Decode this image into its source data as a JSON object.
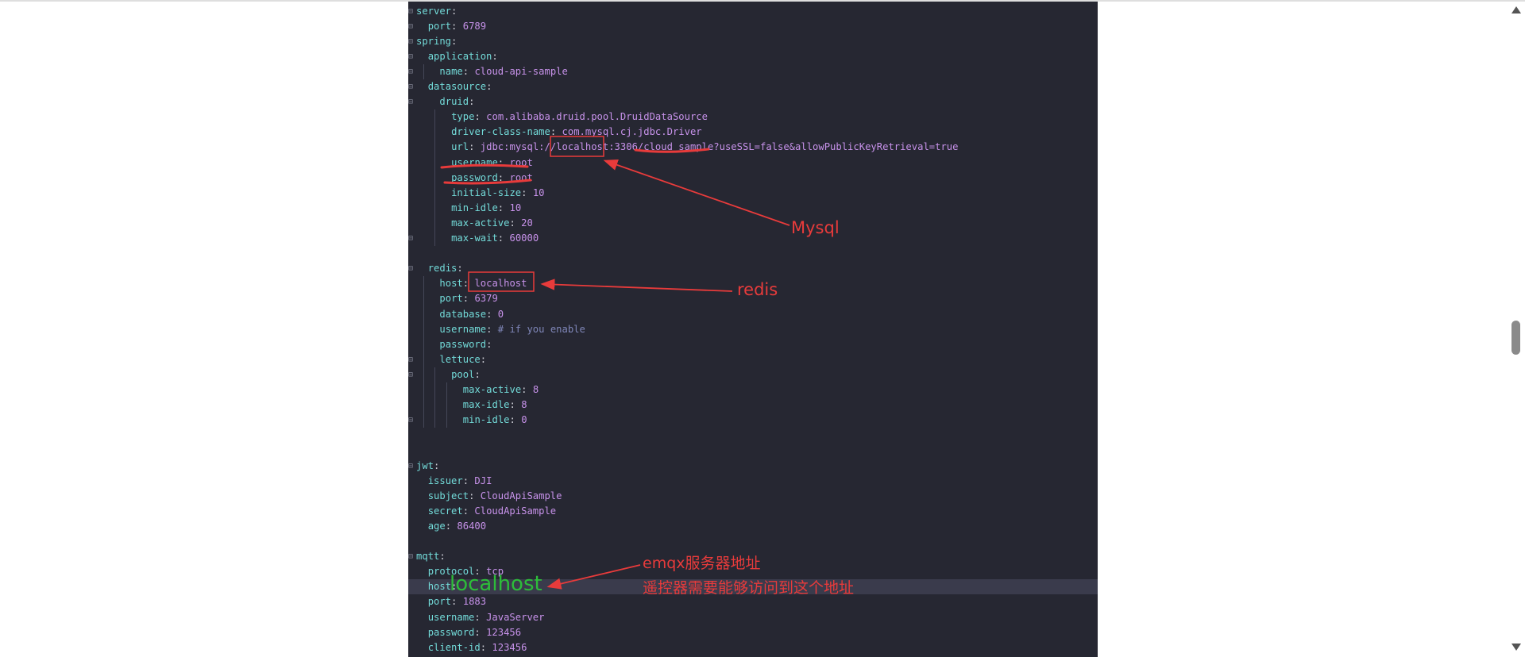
{
  "editor": {
    "lines": [
      {
        "indent": 0,
        "key": "server",
        "sep": ":",
        "value": "",
        "vclass": "v",
        "gutter": "⊟"
      },
      {
        "indent": 1,
        "key": "port",
        "sep": ": ",
        "value": "6789",
        "vclass": "v",
        "gutter": "⊟"
      },
      {
        "indent": 0,
        "key": "spring",
        "sep": ":",
        "value": "",
        "vclass": "v",
        "gutter": "⊟"
      },
      {
        "indent": 1,
        "key": "application",
        "sep": ":",
        "value": "",
        "vclass": "v",
        "gutter": "⊟"
      },
      {
        "indent": 2,
        "key": "name",
        "sep": ": ",
        "value": "cloud-api-sample",
        "vclass": "v",
        "gutter": "⊟"
      },
      {
        "indent": 1,
        "key": "datasource",
        "sep": ":",
        "value": "",
        "vclass": "v",
        "gutter": "⊟"
      },
      {
        "indent": 2,
        "key": "druid",
        "sep": ":",
        "value": "",
        "vclass": "v",
        "gutter": "⊟"
      },
      {
        "indent": 3,
        "key": "type",
        "sep": ": ",
        "value": "com.alibaba.druid.pool.DruidDataSource",
        "vclass": "v",
        "gutter": ""
      },
      {
        "indent": 3,
        "key": "driver-class-name",
        "sep": ": ",
        "value": "com.mysql.cj.jdbc.Driver",
        "vclass": "v",
        "gutter": ""
      },
      {
        "indent": 3,
        "key": "url",
        "sep": ": ",
        "value": "jdbc:mysql://localhost:3306/cloud_sample?useSSL=false&allowPublicKeyRetrieval=true",
        "vclass": "v",
        "gutter": ""
      },
      {
        "indent": 3,
        "key": "username",
        "sep": ": ",
        "value": "root",
        "vclass": "v",
        "gutter": ""
      },
      {
        "indent": 3,
        "key": "password",
        "sep": ": ",
        "value": "root",
        "vclass": "v",
        "gutter": ""
      },
      {
        "indent": 3,
        "key": "initial-size",
        "sep": ": ",
        "value": "10",
        "vclass": "v",
        "gutter": ""
      },
      {
        "indent": 3,
        "key": "min-idle",
        "sep": ": ",
        "value": "10",
        "vclass": "v",
        "gutter": ""
      },
      {
        "indent": 3,
        "key": "max-active",
        "sep": ": ",
        "value": "20",
        "vclass": "v",
        "gutter": ""
      },
      {
        "indent": 3,
        "key": "max-wait",
        "sep": ": ",
        "value": "60000",
        "vclass": "v",
        "gutter": "⊟"
      },
      {
        "indent": 0,
        "key": "",
        "sep": "",
        "value": "",
        "vclass": "v",
        "gutter": ""
      },
      {
        "indent": 1,
        "key": "redis",
        "sep": ":",
        "value": "",
        "vclass": "v",
        "gutter": "⊟"
      },
      {
        "indent": 2,
        "key": "host",
        "sep": ": ",
        "value": "localhost",
        "vclass": "v",
        "gutter": ""
      },
      {
        "indent": 2,
        "key": "port",
        "sep": ": ",
        "value": "6379",
        "vclass": "v",
        "gutter": ""
      },
      {
        "indent": 2,
        "key": "database",
        "sep": ": ",
        "value": "0",
        "vclass": "v",
        "gutter": ""
      },
      {
        "indent": 2,
        "key": "username",
        "sep": ": ",
        "value": "# if you enable",
        "vclass": "c",
        "gutter": ""
      },
      {
        "indent": 2,
        "key": "password",
        "sep": ":",
        "value": "",
        "vclass": "v",
        "gutter": ""
      },
      {
        "indent": 2,
        "key": "lettuce",
        "sep": ":",
        "value": "",
        "vclass": "v",
        "gutter": "⊟"
      },
      {
        "indent": 3,
        "key": "pool",
        "sep": ":",
        "value": "",
        "vclass": "v",
        "gutter": "⊟"
      },
      {
        "indent": 4,
        "key": "max-active",
        "sep": ": ",
        "value": "8",
        "vclass": "v",
        "gutter": ""
      },
      {
        "indent": 4,
        "key": "max-idle",
        "sep": ": ",
        "value": "8",
        "vclass": "v",
        "gutter": ""
      },
      {
        "indent": 4,
        "key": "min-idle",
        "sep": ": ",
        "value": "0",
        "vclass": "v",
        "gutter": "⊟"
      },
      {
        "indent": 0,
        "key": "",
        "sep": "",
        "value": "",
        "vclass": "v",
        "gutter": ""
      },
      {
        "indent": 0,
        "key": "",
        "sep": "",
        "value": "",
        "vclass": "v",
        "gutter": ""
      },
      {
        "indent": 0,
        "key": "jwt",
        "sep": ":",
        "value": "",
        "vclass": "v",
        "gutter": "⊟"
      },
      {
        "indent": 1,
        "key": "issuer",
        "sep": ": ",
        "value": "DJI",
        "vclass": "v",
        "gutter": ""
      },
      {
        "indent": 1,
        "key": "subject",
        "sep": ": ",
        "value": "CloudApiSample",
        "vclass": "v",
        "gutter": ""
      },
      {
        "indent": 1,
        "key": "secret",
        "sep": ": ",
        "value": "CloudApiSample",
        "vclass": "v",
        "gutter": ""
      },
      {
        "indent": 1,
        "key": "age",
        "sep": ": ",
        "value": "86400",
        "vclass": "v",
        "gutter": ""
      },
      {
        "indent": 0,
        "key": "",
        "sep": "",
        "value": "",
        "vclass": "v",
        "gutter": ""
      },
      {
        "indent": 0,
        "key": "mqtt",
        "sep": ":",
        "value": "",
        "vclass": "v",
        "gutter": "⊟"
      },
      {
        "indent": 1,
        "key": "protocol",
        "sep": ": ",
        "value": "tcp",
        "vclass": "v",
        "gutter": ""
      },
      {
        "indent": 1,
        "key": "host",
        "sep": ": ",
        "value": "",
        "vclass": "v",
        "gutter": "",
        "highlight": true
      },
      {
        "indent": 1,
        "key": "port",
        "sep": ": ",
        "value": "1883",
        "vclass": "v",
        "gutter": ""
      },
      {
        "indent": 1,
        "key": "username",
        "sep": ": ",
        "value": "JavaServer",
        "vclass": "v",
        "gutter": ""
      },
      {
        "indent": 1,
        "key": "password",
        "sep": ": ",
        "value": "123456",
        "vclass": "v",
        "gutter": ""
      },
      {
        "indent": 1,
        "key": "client-id",
        "sep": ": ",
        "value": "123456",
        "vclass": "v",
        "gutter": ""
      }
    ]
  },
  "annotations": {
    "mysql_label": "Mysql",
    "redis_label": "redis",
    "emqx_label": "emqx服务器地址",
    "emqx_note": "遥控器需要能够访问到这个地址",
    "mqtt_host_handwritten": "localhost"
  },
  "colors": {
    "editor_bg": "#262732",
    "key": "#73dbd9",
    "value": "#c792ea",
    "comment": "#7f86b8",
    "annotation_red": "#e83b3b",
    "annotation_green": "#2dbc3a"
  }
}
